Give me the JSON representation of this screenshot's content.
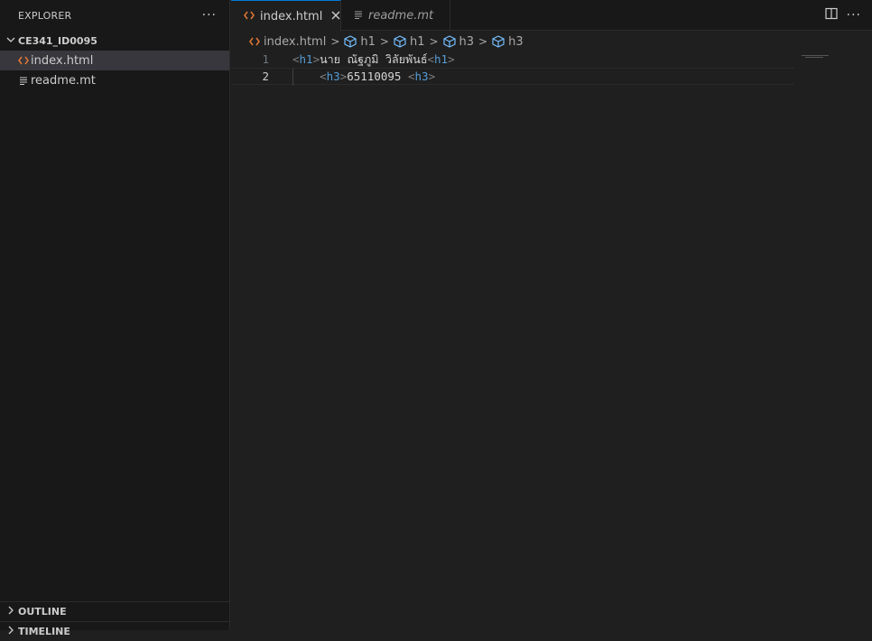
{
  "sidebar": {
    "title": "EXPLORER",
    "more": "···",
    "folder": "CE341_ID0095",
    "files": [
      {
        "label": "index.html",
        "icon": "html-icon"
      },
      {
        "label": "readme.mt",
        "icon": "text-file-icon"
      }
    ],
    "outline": "OUTLINE",
    "timeline": "TIMELINE"
  },
  "tabs": [
    {
      "label": "index.html",
      "icon": "html-icon",
      "active": true
    },
    {
      "label": "readme.mt",
      "icon": "text-file-icon",
      "active": false
    }
  ],
  "tab_actions": {
    "more": "···"
  },
  "breadcrumb": [
    "index.html",
    "h1",
    "h1",
    "h3",
    "h3"
  ],
  "editor": {
    "lines": [
      {
        "number": "1",
        "open_tag": "h1",
        "text": "นาย ณัฐภูมิ วิลัยพันธ์",
        "close_tag": "h1"
      },
      {
        "number": "2",
        "indent": "    ",
        "open_tag": "h3",
        "text": "65110095 ",
        "close_tag": "h3"
      }
    ]
  },
  "colors": {
    "accent": "#0078d4",
    "html_icon": "#e37933",
    "tag": "#569cd6",
    "symbol_icon": "#75beff"
  }
}
